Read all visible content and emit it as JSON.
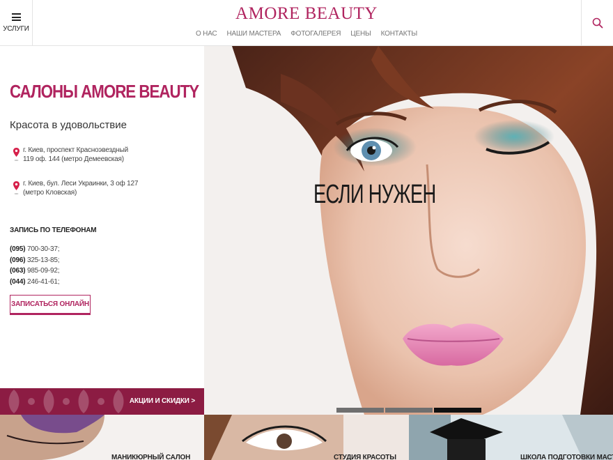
{
  "header": {
    "menu_label": "УСЛУГИ",
    "logo": "AMORE BEAUTY",
    "nav": [
      "О НАС",
      "НАШИ МАСТЕРА",
      "ФОТОГАЛЕРЕЯ",
      "ЦЕНЫ",
      "КОНТАКТЫ"
    ],
    "menu_icon": "hamburger-icon",
    "search_icon": "search-icon"
  },
  "info": {
    "title": "САЛОНЫ AMORE BEAUTY",
    "tagline": "Красота в удовольствие",
    "addresses": [
      {
        "line1": "г. Киев, проспект Красноэвездный",
        "line2": "119 оф. 144 (метро Демеевская)"
      },
      {
        "line1": "г. Киев, бул. Леси Украинки, 3 оф 127",
        "line2": "(метро Кловская)"
      }
    ],
    "phones_title": "ЗАПИСЬ ПО ТЕЛЕФОНАМ",
    "phones": [
      {
        "code": "(095)",
        "number": "700-30-37;"
      },
      {
        "code": "(096)",
        "number": "325-13-85;"
      },
      {
        "code": "(063)",
        "number": "985-09-92;"
      },
      {
        "code": "(044)",
        "number": "246-41-61;"
      }
    ],
    "book_button": "ЗАПИСАТЬСЯ ОНЛАЙН"
  },
  "promo": {
    "label": "АКЦИИ И СКИДКИ >"
  },
  "hero": {
    "caption": "ЕСЛИ НУЖЕН",
    "slides": 3,
    "active_slide": 3
  },
  "cards": [
    {
      "label": "МАНИКЮРНЫЙ САЛОН"
    },
    {
      "label": "СТУДИЯ КРАСОТЫ"
    },
    {
      "label": "ШКОЛА ПОДГОТОВКИ МАСТЕРОВ"
    }
  ],
  "colors": {
    "brand": "#b0245f",
    "promo_bg": "#8c1c43"
  }
}
